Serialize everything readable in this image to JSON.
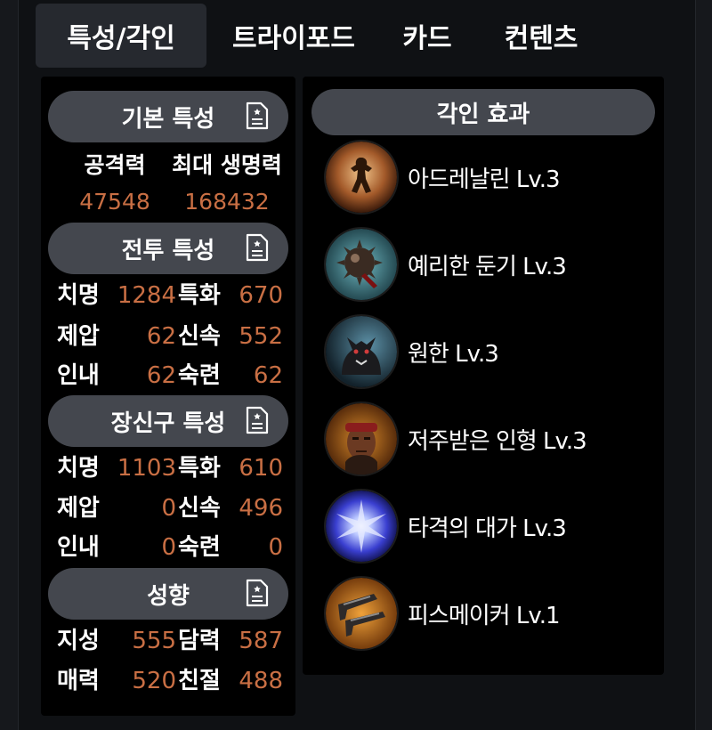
{
  "tabs": [
    "특성/각인",
    "트라이포드",
    "카드",
    "컨텐츠"
  ],
  "basic": {
    "title": "기본 특성",
    "attack_label": "공격력",
    "hp_label": "최대 생명력",
    "attack_value": "47548",
    "hp_value": "168432"
  },
  "combat": {
    "title": "전투 특성",
    "rows": [
      {
        "k1": "치명",
        "v1": "1284",
        "k2": "특화",
        "v2": "670"
      },
      {
        "k1": "제압",
        "v1": "62",
        "k2": "신속",
        "v2": "552"
      },
      {
        "k1": "인내",
        "v1": "62",
        "k2": "숙련",
        "v2": "62"
      }
    ]
  },
  "accessory": {
    "title": "장신구 특성",
    "rows": [
      {
        "k1": "치명",
        "v1": "1103",
        "k2": "특화",
        "v2": "610"
      },
      {
        "k1": "제압",
        "v1": "0",
        "k2": "신속",
        "v2": "496"
      },
      {
        "k1": "인내",
        "v1": "0",
        "k2": "숙련",
        "v2": "0"
      }
    ]
  },
  "tendency": {
    "title": "성향",
    "rows": [
      {
        "k1": "지성",
        "v1": "555",
        "k2": "담력",
        "v2": "587"
      },
      {
        "k1": "매력",
        "v1": "520",
        "k2": "친절",
        "v2": "488"
      }
    ]
  },
  "engravings": {
    "title": "각인 효과",
    "items": [
      {
        "name": "아드레날린 Lv.3",
        "icon": "adrenaline-icon"
      },
      {
        "name": "예리한 둔기 Lv.3",
        "icon": "keen-blunt-weapon-icon"
      },
      {
        "name": "원한 Lv.3",
        "icon": "grudge-icon"
      },
      {
        "name": "저주받은 인형 Lv.3",
        "icon": "cursed-doll-icon"
      },
      {
        "name": "타격의 대가 Lv.3",
        "icon": "hit-master-icon"
      },
      {
        "name": "피스메이커 Lv.1",
        "icon": "peacemaker-icon"
      }
    ]
  },
  "colors": {
    "value": "#c96f44",
    "pill": "#44474e",
    "tab_active": "#26292f"
  }
}
